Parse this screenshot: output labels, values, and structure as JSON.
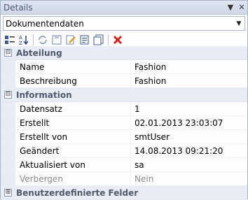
{
  "window": {
    "title": "Details"
  },
  "combo": {
    "value": "Dokumentendaten"
  },
  "categories": [
    {
      "label": "Abteilung",
      "expander": "⊟",
      "rows": [
        {
          "key": "Name",
          "value": "Fashion"
        },
        {
          "key": "Beschreibung",
          "value": "Fashion"
        }
      ]
    },
    {
      "label": "Information",
      "expander": "⊟",
      "rows": [
        {
          "key": "Datensatz",
          "value": "1"
        },
        {
          "key": "Erstellt",
          "value": "02.01.2013 23:03:07"
        },
        {
          "key": "Erstellt von",
          "value": "smtUser"
        },
        {
          "key": "Geändert",
          "value": "14.08.2013 09:21:20"
        },
        {
          "key": "Aktualisiert von",
          "value": "sa"
        },
        {
          "key": "Verbergen",
          "value": "Nein"
        }
      ]
    },
    {
      "label": "Benutzerdefinierte Felder",
      "expander": "⊞"
    }
  ],
  "colors": {
    "delete": "#d21f1f",
    "accent": "#4c5a72"
  }
}
